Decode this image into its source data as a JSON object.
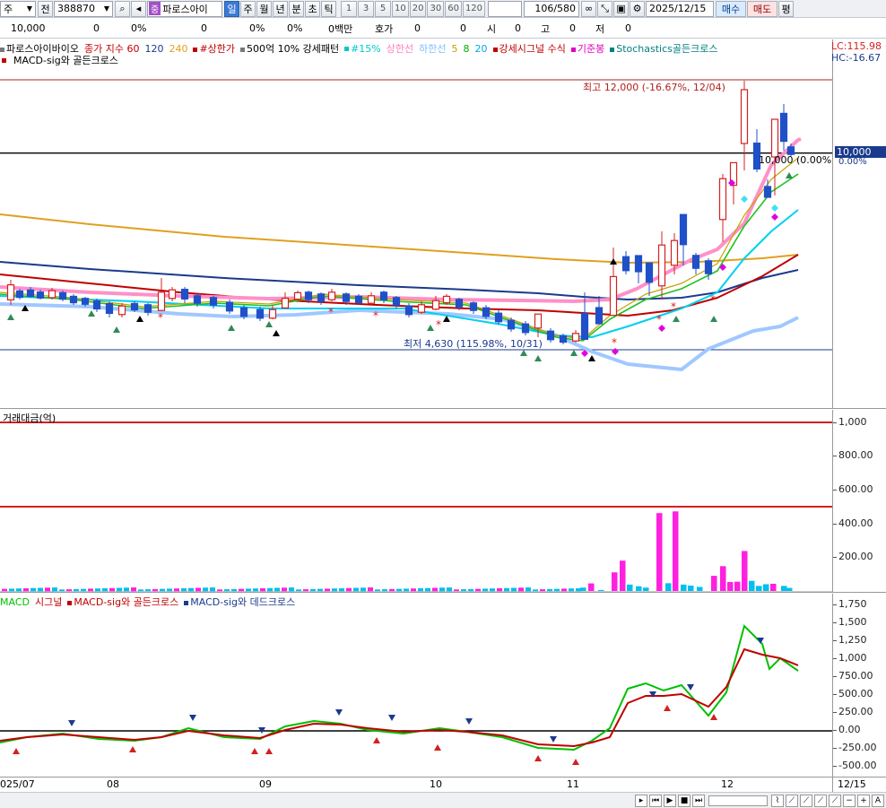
{
  "toolbar": {
    "period_type": "주",
    "prev_label": "전",
    "stock_code": "388870",
    "stock_badge": "중",
    "stock_name": "파로스아이",
    "periods": [
      "일",
      "주",
      "월",
      "년",
      "분",
      "초",
      "틱"
    ],
    "intervals": [
      "1",
      "3",
      "5",
      "10",
      "20",
      "30",
      "60",
      "120"
    ],
    "page_count": "106",
    "page_total": "/580",
    "date": "2025/12/15",
    "buy_label": "매수",
    "sell_label": "매도",
    "eval_label": "평"
  },
  "quote": {
    "price": "10,000",
    "change": "0",
    "change_pct": "0%",
    "volume": "0",
    "volume_pct": "0%",
    "amount_pct": "0%",
    "unit": "0백만",
    "ask_label": "호가",
    "ask": "0",
    "bid": "0",
    "open_label": "시",
    "open": "0",
    "high_label": "고",
    "high": "0",
    "low_label": "저",
    "low": "0"
  },
  "price_pane": {
    "legend": [
      {
        "text": "파로스아이바이오",
        "color": "#000000"
      },
      {
        "text": "종가 지수 60",
        "color": "#c00000"
      },
      {
        "text": "120",
        "color": "#1a3a8c"
      },
      {
        "text": "240",
        "color": "#e0a020"
      },
      {
        "text": "#상한가",
        "color": "#c00000"
      },
      {
        "text": "500억 10% 강세패턴",
        "color": "#000000"
      },
      {
        "text": "#15%",
        "color": "#00c8c8"
      },
      {
        "text": "상한선",
        "color": "#ff80c0"
      },
      {
        "text": "하한선",
        "color": "#80c0ff"
      },
      {
        "text": "5",
        "color": "#c8a000"
      },
      {
        "text": "8",
        "color": "#00b000"
      },
      {
        "text": "20",
        "color": "#00a8e0"
      },
      {
        "text": "강세시그널 수식",
        "color": "#c00000"
      },
      {
        "text": "기준봉",
        "color": "#e000c0"
      },
      {
        "text": "Stochastics골든크로스",
        "color": "#008080"
      }
    ],
    "legend_line2": "MACD-sig와 골든크로스",
    "lc_label": "LC:115.98",
    "hc_label": "HC:-16.67",
    "high_annot": "최고 12,000 (-16.67%, 12/04)",
    "low_annot": "최저 4,630 (115.98%, 10/31)",
    "current_annot": "10,000 (0.00%)",
    "current_price_tag": "10,000",
    "current_pct_tag": "0.00%",
    "colors": {
      "up": "#d42020",
      "down": "#2050c8",
      "ma60": "#c00000",
      "ma120": "#1a3a8c",
      "ma240": "#e0a020"
    }
  },
  "volume_pane": {
    "title": "거래대금(억)",
    "ticks": [
      "1,000",
      "800.00",
      "600.00",
      "400.00",
      "200.00"
    ],
    "colors": {
      "big": "#ff20e0",
      "small": "#00c0f0"
    }
  },
  "macd_pane": {
    "legend": [
      {
        "text": "MACD",
        "color": "#00c000"
      },
      {
        "text": "시그널",
        "color": "#c00000"
      },
      {
        "text": "MACD-sig와 골든크로스",
        "color": "#c00000"
      },
      {
        "text": "MACD-sig와 데드크로스",
        "color": "#1a3a8c"
      }
    ],
    "ticks": [
      "1,750",
      "1,500",
      "1,250",
      "1,000",
      "750.00",
      "500.00",
      "250.00",
      "0.00",
      "-250.00",
      "-500.00"
    ]
  },
  "xaxis": {
    "labels": [
      "025/07",
      "08",
      "09",
      "10",
      "11",
      "12"
    ],
    "right_label": "12/15"
  },
  "chart_data": {
    "type": "candlestick",
    "title": "파로스아이바이오",
    "price_high": 12000,
    "price_low": 4630,
    "current": 10000,
    "volume_ylim": [
      0,
      1000
    ],
    "volume_bars_approx": [
      {
        "period": "2025-11 early",
        "value": 60
      },
      {
        "period": "2025-11",
        "value": 200
      },
      {
        "period": "2025-11",
        "value": 330
      },
      {
        "period": "2025-11 late",
        "value": 450
      },
      {
        "period": "2025-11 late",
        "value": 460
      },
      {
        "period": "2025-12 early",
        "value": 270
      },
      {
        "period": "2025-12",
        "value": 430
      },
      {
        "period": "2025-12",
        "value": 120
      }
    ],
    "macd_ylim": [
      -500,
      1750
    ],
    "macd_peak": 1450,
    "signal_peak": 1100
  }
}
